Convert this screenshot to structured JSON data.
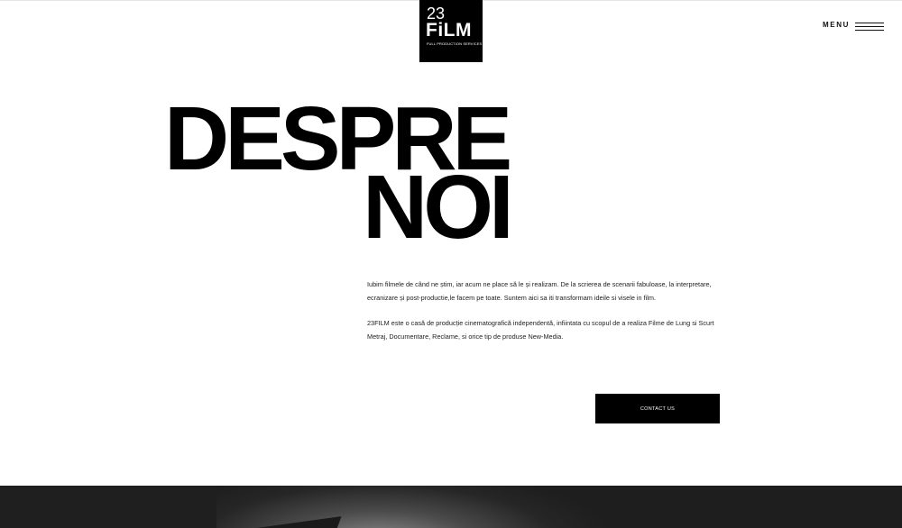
{
  "logo": {
    "line1": "23",
    "line2": "FiLM",
    "tagline": "FULL PRODUCTION SERVICES"
  },
  "menu": {
    "label": "MENU",
    "icon": "hamburger-icon"
  },
  "headline": {
    "line1": "DESPRE",
    "line2": "NOI"
  },
  "about": {
    "paragraph1": "Iubim filmele de când ne știm, iar acum ne place să le și realizam. De la scrierea de scenarii fabuloase, la interpretare, ecranizare și post-productie,le facem pe toate. Suntem aici sa iti transformam ideile si visele in film.",
    "paragraph2": "23FILM este o casă de producție cinematografică independentă, infiintata cu scopul de a realiza Filme de Lung si Scurt Metraj, Documentare, Reclame, si orice tip de produse  New-Media."
  },
  "contact_button": {
    "label": "CONTACT US"
  },
  "colors": {
    "background": "#ffffff",
    "text": "#000000",
    "button": "#000000",
    "button_text": "#ffffff"
  }
}
